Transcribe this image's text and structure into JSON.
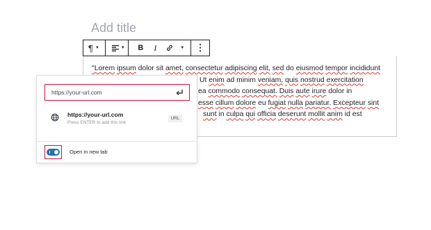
{
  "post": {
    "title_placeholder": "Add title"
  },
  "toolbar": {
    "paragraph_icon": "¶",
    "align_icon": "align-left-icon",
    "bold": "B",
    "italic": "I",
    "link_icon": "link-icon",
    "more_icon": "⋮"
  },
  "editor": {
    "line1": "\"Lorem ipsum dolor sit amet, consectetur adipiscing elit, sed do eiusmod tempor incididunt",
    "line2": "Ut enim ad minim veniam, quis nostrud exercitation",
    "line3": "ea commodo consequat. Duis aute irure dolor in",
    "line4": "esse cillum dolore eu fugiat nulla pariatur. Excepteur sint",
    "line5": "sunt in culpa qui officia deserunt mollit anim id est"
  },
  "link_popover": {
    "url_value": "https://your-url.com",
    "submit_icon": "enter-icon",
    "suggestion": {
      "icon": "globe-icon",
      "title": "https://your-url.com",
      "hint": "Press ENTER to add this link",
      "type_badge": "URL"
    },
    "open_new_tab": {
      "label": "Open in new tab",
      "checked": true
    },
    "highlight_color": "#d6113e",
    "accent_color": "#2271b1"
  }
}
